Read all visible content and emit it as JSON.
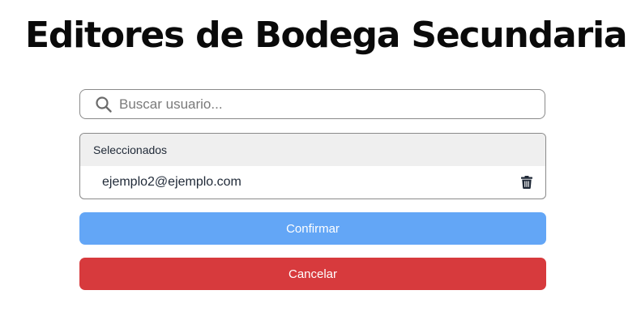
{
  "page": {
    "title": "Editores de Bodega Secundaria"
  },
  "search": {
    "placeholder": "Buscar usuario...",
    "icon": "search-icon"
  },
  "selected": {
    "header": "Seleccionados",
    "items": [
      {
        "email": "ejemplo2@ejemplo.com",
        "action_icon": "trash-icon"
      }
    ]
  },
  "actions": {
    "confirm_label": "Confirmar",
    "cancel_label": "Cancelar"
  },
  "colors": {
    "confirm": "#63a6f6",
    "cancel": "#d73a3d",
    "header_bg": "#efefef"
  }
}
